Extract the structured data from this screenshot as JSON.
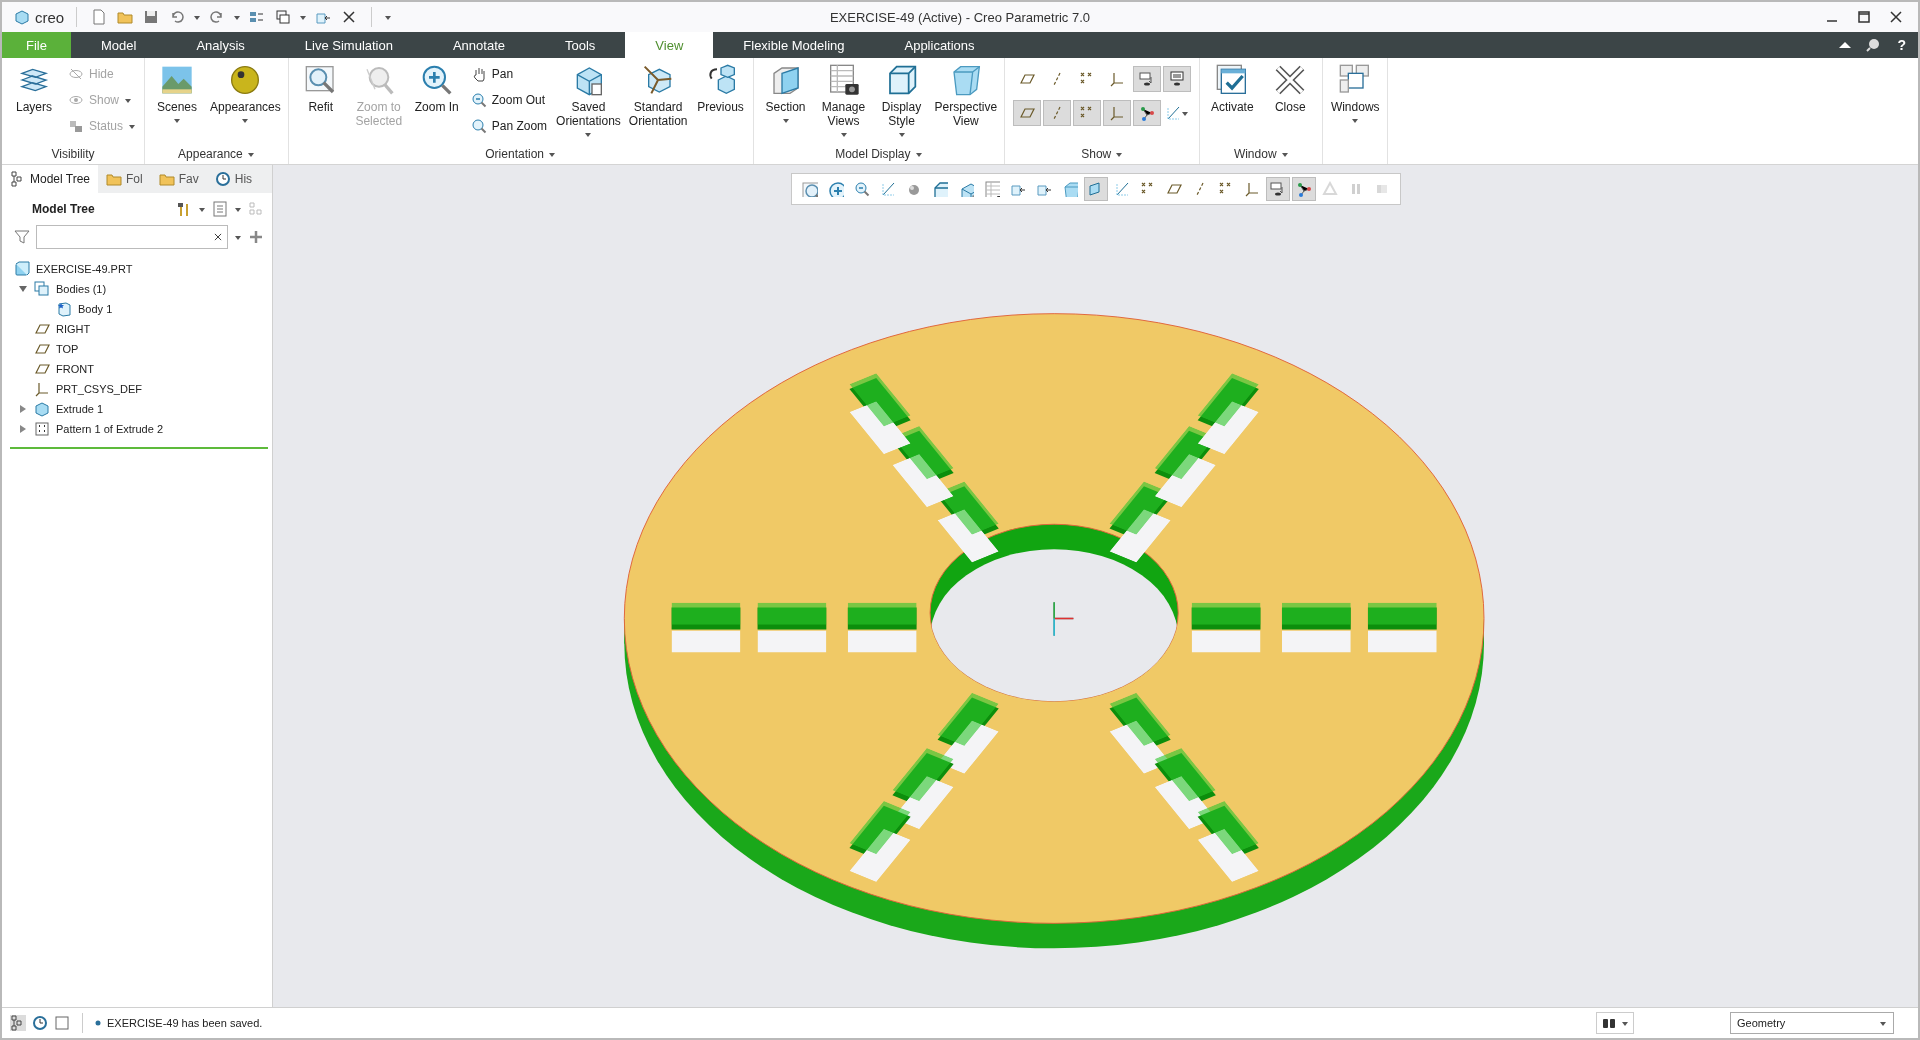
{
  "window": {
    "title": "EXERCISE-49 (Active) - Creo Parametric 7.0",
    "logo": "creo"
  },
  "tabs": [
    {
      "label": "File",
      "kind": "file",
      "selected": false
    },
    {
      "label": "Model",
      "kind": "tab",
      "selected": false
    },
    {
      "label": "Analysis",
      "kind": "tab",
      "selected": false
    },
    {
      "label": "Live Simulation",
      "kind": "tab",
      "selected": false
    },
    {
      "label": "Annotate",
      "kind": "tab",
      "selected": false
    },
    {
      "label": "Tools",
      "kind": "tab",
      "selected": false
    },
    {
      "label": "View",
      "kind": "tab",
      "selected": true
    },
    {
      "label": "Flexible Modeling",
      "kind": "tab",
      "selected": false
    },
    {
      "label": "Applications",
      "kind": "tab",
      "selected": false
    }
  ],
  "help": "?",
  "ribbon": {
    "groups": [
      {
        "label": "Visibility",
        "menu": false,
        "items": [
          {
            "label": "Layers",
            "kind": "large",
            "disabled": false,
            "dropdown": false
          },
          {
            "label": "Hide",
            "kind": "small",
            "disabled": true,
            "dropdown": false
          },
          {
            "label": "Show",
            "kind": "small",
            "disabled": true,
            "dropdown": true
          },
          {
            "label": "Status",
            "kind": "small",
            "disabled": true,
            "dropdown": true
          }
        ]
      },
      {
        "label": "Appearance",
        "menu": true,
        "items": [
          {
            "label": "Scenes",
            "kind": "large",
            "disabled": false,
            "dropdown": true
          },
          {
            "label": "Appearances",
            "kind": "large",
            "disabled": false,
            "dropdown": true
          }
        ]
      },
      {
        "label": "Orientation",
        "menu": true,
        "items": [
          {
            "label": "Refit",
            "kind": "large",
            "disabled": false,
            "dropdown": false
          },
          {
            "label": "Zoom to Selected",
            "kind": "large",
            "disabled": true,
            "dropdown": false
          },
          {
            "label": "Zoom In",
            "kind": "large",
            "disabled": false,
            "dropdown": false
          },
          {
            "label": "Pan",
            "kind": "small",
            "disabled": false,
            "dropdown": false
          },
          {
            "label": "Zoom Out",
            "kind": "small",
            "disabled": false,
            "dropdown": false
          },
          {
            "label": "Pan Zoom",
            "kind": "small",
            "disabled": false,
            "dropdown": false
          },
          {
            "label": "Saved Orientations",
            "kind": "large",
            "disabled": false,
            "dropdown": true
          },
          {
            "label": "Standard Orientation",
            "kind": "large",
            "disabled": false,
            "dropdown": false
          },
          {
            "label": "Previous",
            "kind": "large",
            "disabled": false,
            "dropdown": false
          }
        ]
      },
      {
        "label": "Model Display",
        "menu": true,
        "items": [
          {
            "label": "Section",
            "kind": "large",
            "disabled": false,
            "dropdown": true
          },
          {
            "label": "Manage Views",
            "kind": "large",
            "disabled": false,
            "dropdown": true
          },
          {
            "label": "Display Style",
            "kind": "large",
            "disabled": false,
            "dropdown": true
          },
          {
            "label": "Perspective View",
            "kind": "large",
            "disabled": false,
            "dropdown": false
          }
        ]
      },
      {
        "label": "Show",
        "menu": true,
        "items": [
          {
            "kind": "icon",
            "toggled": false,
            "dropdown": false
          },
          {
            "kind": "icon",
            "toggled": false,
            "dropdown": false
          },
          {
            "kind": "icon",
            "toggled": false,
            "dropdown": false
          },
          {
            "kind": "icon",
            "toggled": false,
            "dropdown": false
          },
          {
            "kind": "icon",
            "toggled": true,
            "dropdown": false
          },
          {
            "kind": "icon",
            "toggled": true,
            "dropdown": false
          },
          {
            "kind": "icon",
            "toggled": true,
            "dropdown": false
          },
          {
            "kind": "icon",
            "toggled": true,
            "dropdown": false
          },
          {
            "kind": "icon",
            "toggled": true,
            "dropdown": false
          },
          {
            "kind": "icon",
            "toggled": true,
            "dropdown": false
          },
          {
            "kind": "icon",
            "toggled": true,
            "dropdown": false
          },
          {
            "kind": "icon",
            "toggled": false,
            "dropdown": true
          }
        ]
      },
      {
        "label": "Window",
        "menu": true,
        "items": [
          {
            "label": "Activate",
            "kind": "large",
            "disabled": false,
            "dropdown": false
          },
          {
            "label": "Close",
            "kind": "large",
            "disabled": false,
            "dropdown": false
          }
        ]
      },
      {
        "menu": false,
        "items": [
          {
            "label": "Windows",
            "kind": "large",
            "disabled": false,
            "dropdown": true
          }
        ]
      }
    ]
  },
  "model_tree": {
    "panel_tabs": [
      {
        "label": "Model Tree",
        "selected": true
      },
      {
        "label": "Fol",
        "selected": false
      },
      {
        "label": "Fav",
        "selected": false
      },
      {
        "label": "His",
        "selected": false
      }
    ],
    "title": "Model Tree",
    "tree": [
      {
        "label": "EXERCISE-49.PRT",
        "kind": "part",
        "children": [
          {
            "label": "Bodies (1)",
            "kind": "bodies",
            "expanded": true,
            "children": [
              {
                "label": "Body 1",
                "kind": "body"
              }
            ]
          },
          {
            "label": "RIGHT",
            "kind": "plane"
          },
          {
            "label": "TOP",
            "kind": "plane"
          },
          {
            "label": "FRONT",
            "kind": "plane"
          },
          {
            "label": "PRT_CSYS_DEF",
            "kind": "csys"
          },
          {
            "label": "Extrude 1",
            "kind": "extrude",
            "expanded": false
          },
          {
            "label": "Pattern 1 of Extrude 2",
            "kind": "pattern",
            "expanded": false
          }
        ]
      }
    ]
  },
  "view_toolbar": [
    {
      "toggled": false,
      "disabled": false
    },
    {
      "toggled": false,
      "disabled": false
    },
    {
      "toggled": false,
      "disabled": false
    },
    {
      "toggled": false,
      "disabled": false
    },
    {
      "toggled": false,
      "disabled": false
    },
    {
      "toggled": false,
      "disabled": false
    },
    {
      "toggled": false,
      "disabled": false
    },
    {
      "toggled": false,
      "disabled": false
    },
    {
      "toggled": false,
      "disabled": false
    },
    {
      "toggled": false,
      "disabled": false
    },
    {
      "toggled": false,
      "disabled": false
    },
    {
      "toggled": true,
      "disabled": false
    },
    {
      "toggled": false,
      "disabled": false
    },
    {
      "toggled": false,
      "disabled": false
    },
    {
      "toggled": false,
      "disabled": false
    },
    {
      "toggled": false,
      "disabled": false
    },
    {
      "toggled": false,
      "disabled": false
    },
    {
      "toggled": false,
      "disabled": false
    },
    {
      "toggled": true,
      "disabled": false
    },
    {
      "toggled": true,
      "disabled": false
    },
    {
      "toggled": false,
      "disabled": true
    },
    {
      "toggled": false,
      "disabled": true
    },
    {
      "toggled": false,
      "disabled": true
    }
  ],
  "status_bar": {
    "message": "EXERCISE-49 has been saved.",
    "filter": "Geometry"
  }
}
